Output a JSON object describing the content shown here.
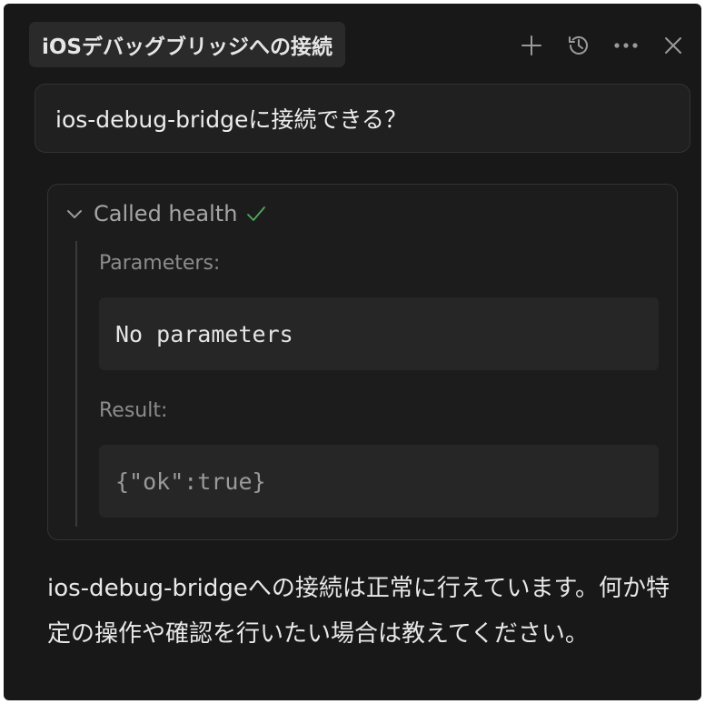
{
  "header": {
    "title": "iOSデバッグブリッジへの接続",
    "icons": [
      "plus-icon",
      "history-icon",
      "more-icon",
      "close-icon"
    ]
  },
  "user_message": "ios-debug-bridgeに接続できる？",
  "tool_call": {
    "label": "Called health",
    "status": "success",
    "parameters_label": "Parameters:",
    "parameters_value": "No parameters",
    "result_label": "Result:",
    "result_value": "{\"ok\":true}"
  },
  "assistant_message": "ios-debug-bridgeへの接続は正常に行えています。何か特定の操作や確認を行いたい場合は教えてください。",
  "colors": {
    "background": "#181818",
    "check": "#4ea95f"
  }
}
